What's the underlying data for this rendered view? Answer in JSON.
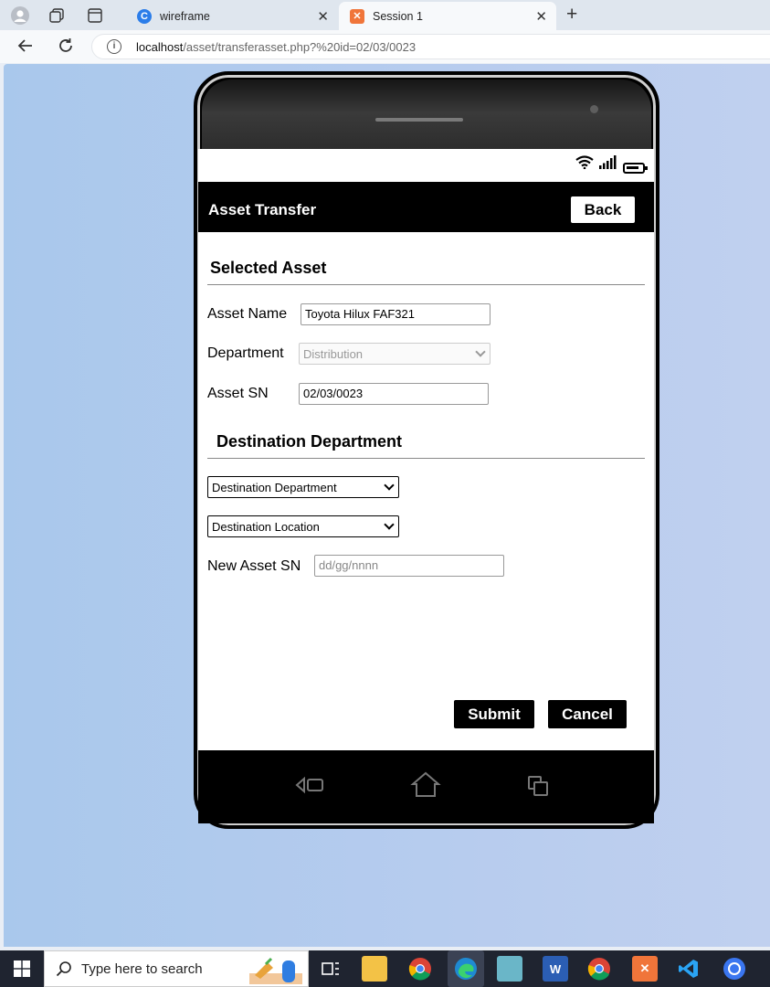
{
  "browser": {
    "tabs": [
      {
        "label": "wireframe",
        "active": false
      },
      {
        "label": "Session 1",
        "active": true
      }
    ],
    "url_host": "localhost",
    "url_path": "/asset/transferasset.php?%20id=02/03/0023"
  },
  "app": {
    "title": "Asset Transfer",
    "back_label": "Back"
  },
  "selected_asset": {
    "heading": "Selected Asset",
    "asset_name_label": "Asset Name",
    "asset_name_value": "Toyota Hilux FAF321",
    "department_label": "Department",
    "department_value": "Distribution",
    "asset_sn_label": "Asset SN",
    "asset_sn_value": "02/03/0023"
  },
  "destination": {
    "heading": "Destination Department",
    "department_select": "Destination Department",
    "location_select": "Destination Location",
    "new_sn_label": "New Asset SN",
    "new_sn_placeholder": "dd/gg/nnnn"
  },
  "actions": {
    "submit_label": "Submit",
    "cancel_label": "Cancel"
  },
  "taskbar": {
    "search_placeholder": "Type here to search"
  },
  "colors": {
    "accent": "#000000",
    "page_background": "#b2cbee"
  }
}
